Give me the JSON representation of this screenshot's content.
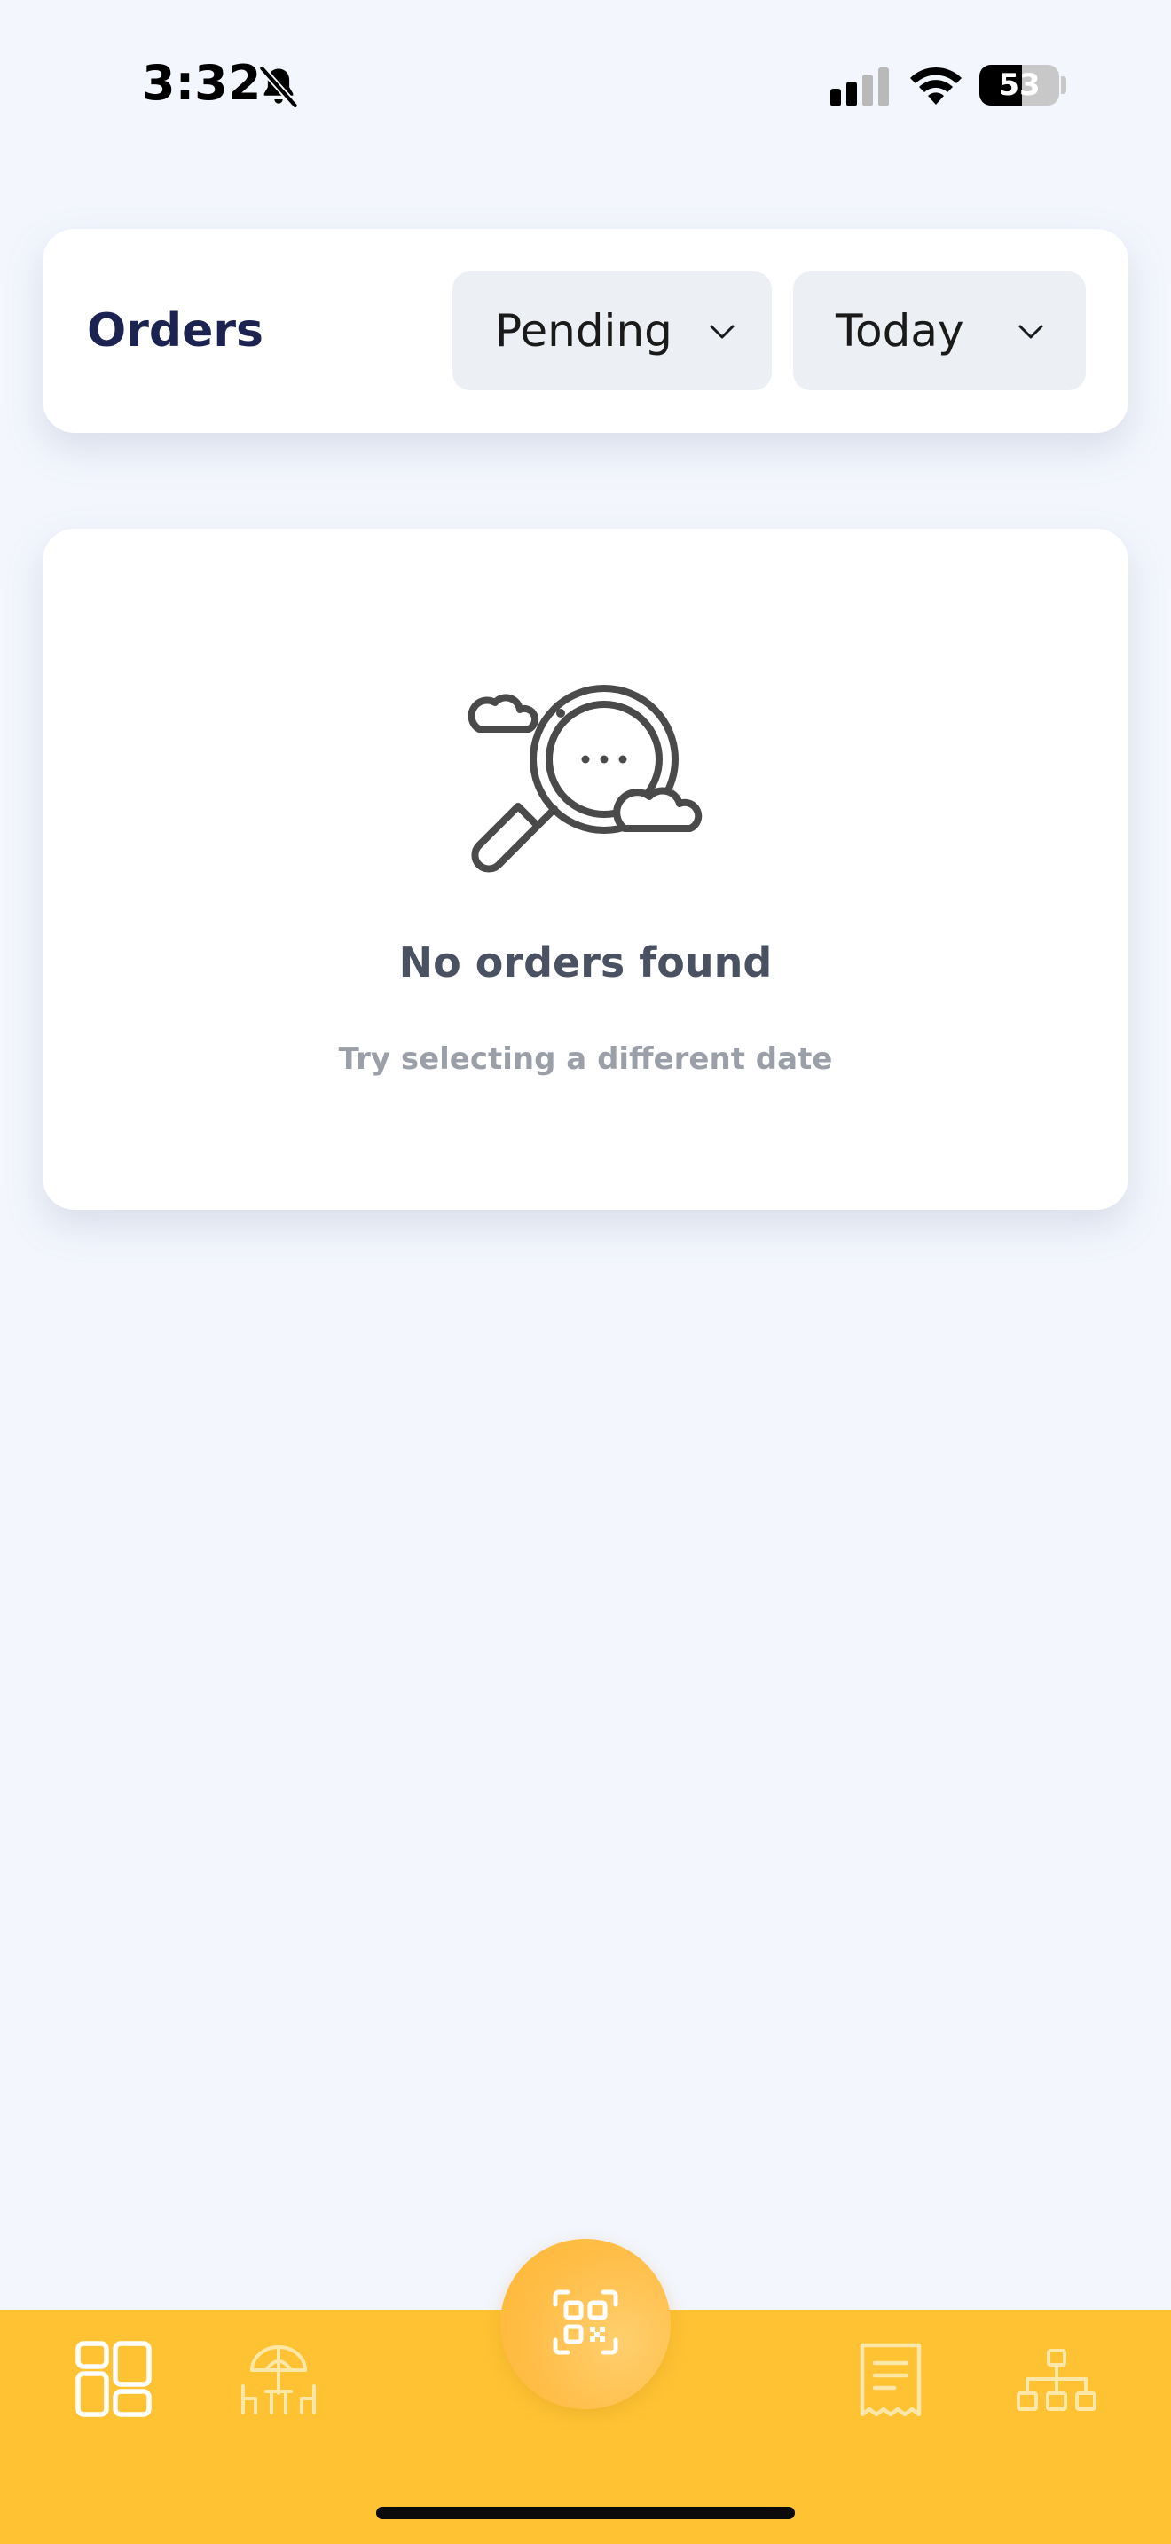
{
  "status_bar": {
    "time": "3:32",
    "battery": "53",
    "battery_level_percent": 53,
    "icons": [
      "bell-slash-icon",
      "cellular-signal-icon",
      "wifi-icon",
      "battery-icon"
    ]
  },
  "header": {
    "title": "Orders",
    "status_filter": {
      "selected": "Pending",
      "icon": "chevron-down-icon"
    },
    "date_filter": {
      "selected": "Today",
      "icon": "chevron-down-icon"
    }
  },
  "empty_state": {
    "icon": "magnifier-clouds-icon",
    "title": "No orders found",
    "subtitle": "Try selecting a different date"
  },
  "bottom_nav": {
    "items": [
      {
        "icon": "dashboard-grid-icon",
        "active": true
      },
      {
        "icon": "beach-umbrella-tables-icon",
        "active": false
      },
      {
        "icon": "qr-scan-icon",
        "active": false
      },
      {
        "icon": "receipt-icon",
        "active": false
      },
      {
        "icon": "org-hierarchy-icon",
        "active": false
      }
    ]
  },
  "colors": {
    "background": "#f3f6fd",
    "title": "#1d2350",
    "nav_bar": "#fec233",
    "fab": "#ffbe48",
    "dropdown_bg": "#eceff4",
    "empty_title": "#4a5160",
    "empty_subtitle": "#9a9fa8"
  }
}
